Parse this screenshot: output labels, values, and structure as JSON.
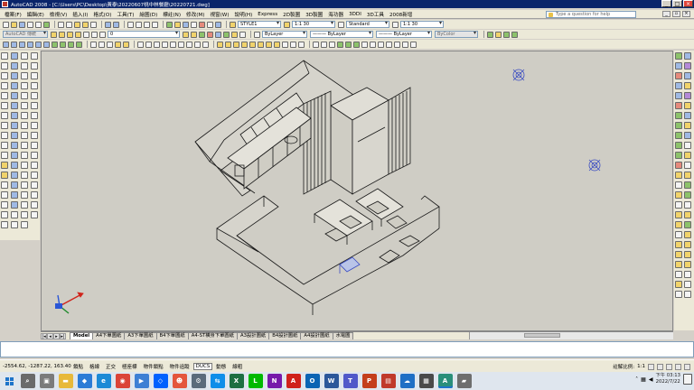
{
  "window": {
    "title": "AutoCAD 2008 - [C:\\Users\\PC\\Desktop\\黃泰\\20220607桃中林餐廳\\20220721.dwg]",
    "controls": [
      "_",
      "□",
      "×"
    ]
  },
  "menu": {
    "items": [
      "檔案(F)",
      "編輯(E)",
      "檢視(V)",
      "插入(I)",
      "格式(O)",
      "工具(T)",
      "繪圖(D)",
      "標註(N)",
      "修改(M)",
      "視窗(W)",
      "說明(H)",
      "Express",
      "2D製圖",
      "3D製圖",
      "海功器",
      "3DDI",
      "3D工具",
      "2008新增"
    ],
    "help_placeholder": "Type a question for help"
  },
  "toolbar1": {
    "text_style": "STYLE1",
    "dim_scale": "1:1 30",
    "dim_style": "Standard",
    "table_scale": "1:1 30"
  },
  "toolbar2": {
    "workspace": "AutoCAD 傳統",
    "layer": "0",
    "color": "ByLayer",
    "linetype": "——— ByLayer",
    "lineweight": "——— ByLayer",
    "plotstyle": "ByColor"
  },
  "layout_tabs": [
    "Model",
    "A4下單圖紙",
    "A3下單圖紙",
    "B4下單圖紙",
    "A4-ST橫身下單圖紙",
    "A3設計圖紙",
    "B4設計圖紙",
    "A4設計圖紙",
    "水電圖"
  ],
  "active_tab": "Model",
  "command_line": {
    "prompt": ""
  },
  "status": {
    "coordinates": "-2554.62, -1287.22, 163.40",
    "toggles": [
      {
        "label": "鎖點",
        "on": false
      },
      {
        "label": "格線",
        "on": false
      },
      {
        "label": "正交",
        "on": false
      },
      {
        "label": "極座標",
        "on": false
      },
      {
        "label": "物件鎖點",
        "on": false
      },
      {
        "label": "物件追蹤",
        "on": false
      },
      {
        "label": "DUCS",
        "on": true
      },
      {
        "label": "動態",
        "on": false
      },
      {
        "label": "線粗",
        "on": false
      }
    ],
    "annotation_scale_label": "註解比例:",
    "annotation_scale_value": "1:1"
  },
  "taskbar": {
    "time": "下午 03:13",
    "date": "2022/7/22",
    "apps": [
      {
        "name": "search-app",
        "glyph": "⌕",
        "color": "#6a6a6a"
      },
      {
        "name": "task-view-app",
        "glyph": "▣",
        "color": "#7b7b7b"
      },
      {
        "name": "file-explorer-app",
        "glyph": "▬",
        "color": "#e8b93a"
      },
      {
        "name": "store-app",
        "glyph": "◆",
        "color": "#2b7bd6"
      },
      {
        "name": "edge-app",
        "glyph": "e",
        "color": "#1c8ad6"
      },
      {
        "name": "chrome-app",
        "glyph": "◉",
        "color": "#db4437"
      },
      {
        "name": "media-app",
        "glyph": "▶",
        "color": "#3d7fd4"
      },
      {
        "name": "dropbox-app",
        "glyph": "◇",
        "color": "#0061fe"
      },
      {
        "name": "photos-app",
        "glyph": "☻",
        "color": "#e4553c"
      },
      {
        "name": "settings-app",
        "glyph": "⚙",
        "color": "#5b6b7b"
      },
      {
        "name": "teamviewer-app",
        "glyph": "⇆",
        "color": "#0e8ee9"
      },
      {
        "name": "excel-app",
        "glyph": "X",
        "color": "#1d6f42"
      },
      {
        "name": "line-app",
        "glyph": "L",
        "color": "#00b900"
      },
      {
        "name": "onenote-app",
        "glyph": "N",
        "color": "#7719aa"
      },
      {
        "name": "acrobat-app",
        "glyph": "A",
        "color": "#d0211b"
      },
      {
        "name": "outlook-app",
        "glyph": "O",
        "color": "#0a64b4"
      },
      {
        "name": "word-app",
        "glyph": "W",
        "color": "#2b579a"
      },
      {
        "name": "teams-app",
        "glyph": "T",
        "color": "#5059c9"
      },
      {
        "name": "powerpoint-app",
        "glyph": "P",
        "color": "#c43e1c"
      },
      {
        "name": "pdf-app",
        "glyph": "▤",
        "color": "#c0392b"
      },
      {
        "name": "onedrive-app",
        "glyph": "☁",
        "color": "#1f6fc5"
      },
      {
        "name": "calculator-app",
        "glyph": "▦",
        "color": "#4a4a4a"
      },
      {
        "name": "autocad-app",
        "glyph": "A",
        "color": "#2a8f7a"
      },
      {
        "name": "photoshop-app",
        "glyph": "▰",
        "color": "#6e6e6e"
      }
    ]
  }
}
